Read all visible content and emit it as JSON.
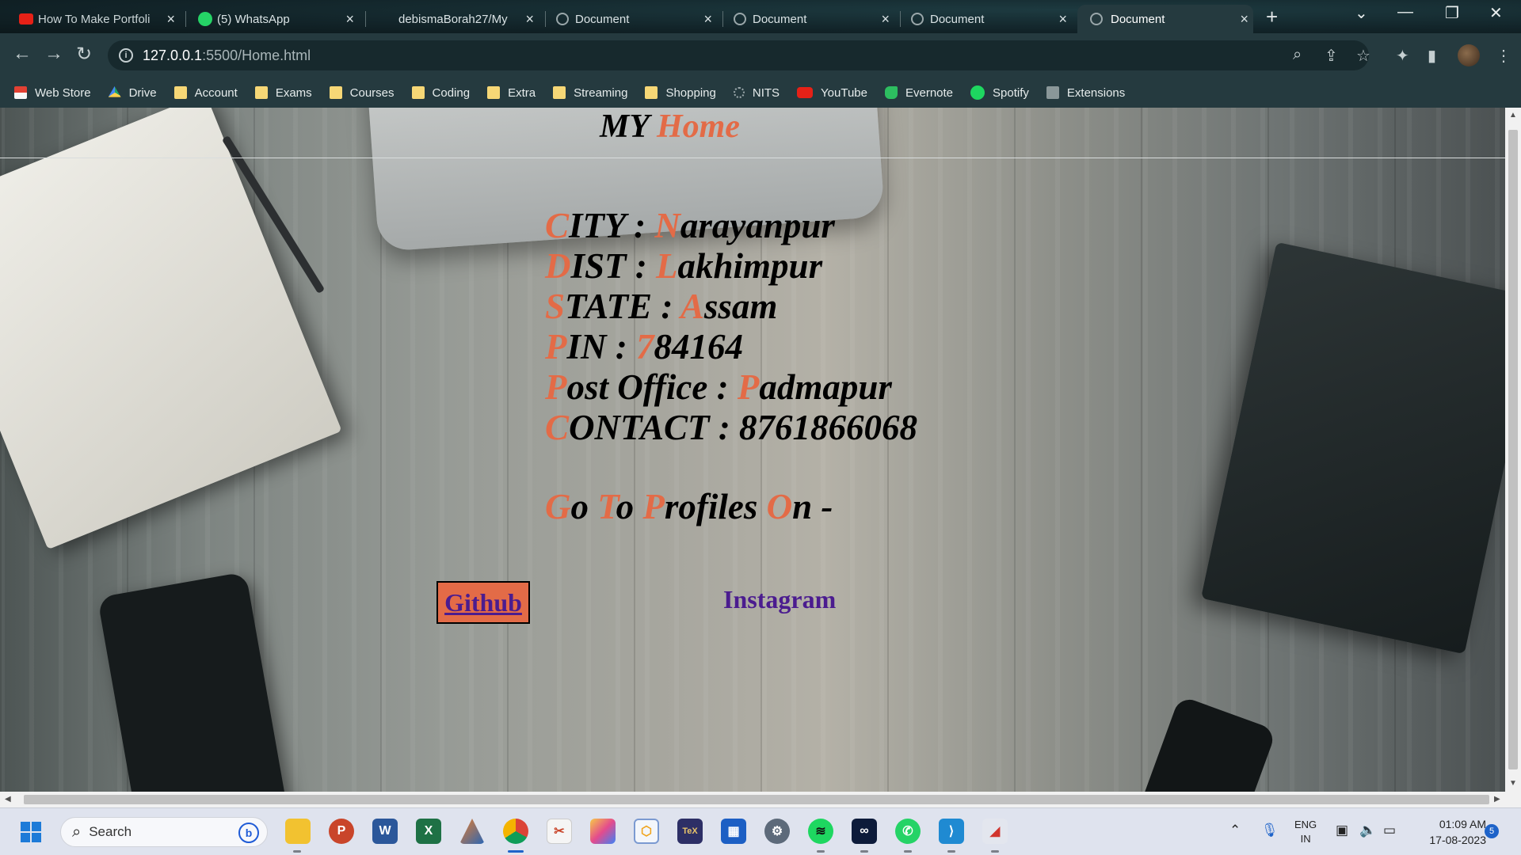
{
  "browser": {
    "tabs": [
      {
        "title": "How To Make Portfoli",
        "icon": "youtube-icon",
        "color": "#e62117"
      },
      {
        "title": "(5) WhatsApp",
        "icon": "whatsapp-icon",
        "color": "#25d366"
      },
      {
        "title": "debismaBorah27/My",
        "icon": "github-icon",
        "color": "#ffffff"
      },
      {
        "title": "Document",
        "icon": "globe-icon",
        "color": "#9aa7aa"
      },
      {
        "title": "Document",
        "icon": "globe-icon",
        "color": "#9aa7aa"
      },
      {
        "title": "Document",
        "icon": "globe-icon",
        "color": "#9aa7aa"
      },
      {
        "title": "Document",
        "icon": "globe-icon",
        "color": "#9aa7aa",
        "active": true
      }
    ],
    "url_host": "127.0.0.1",
    "url_path": ":5500/Home.html",
    "bookmarks": [
      {
        "label": "Web Store",
        "icon": "webstore-icon"
      },
      {
        "label": "Drive",
        "icon": "drive-icon"
      },
      {
        "label": "Account",
        "icon": "folder-icon"
      },
      {
        "label": "Exams",
        "icon": "folder-icon"
      },
      {
        "label": "Courses",
        "icon": "folder-icon"
      },
      {
        "label": "Coding",
        "icon": "folder-icon"
      },
      {
        "label": "Extra",
        "icon": "folder-icon"
      },
      {
        "label": "Streaming",
        "icon": "folder-icon"
      },
      {
        "label": "Shopping",
        "icon": "folder-icon"
      },
      {
        "label": "NITS",
        "icon": "nits-icon"
      },
      {
        "label": "YouTube",
        "icon": "youtube-icon"
      },
      {
        "label": "Evernote",
        "icon": "evernote-icon"
      },
      {
        "label": "Spotify",
        "icon": "spotify-icon"
      },
      {
        "label": "Extensions",
        "icon": "puzzle-icon"
      }
    ]
  },
  "page": {
    "brand_first": "MY",
    "brand_second": "Home",
    "accent_color": "#e36b47",
    "lines": [
      {
        "label_initial": "C",
        "label_rest": "ITY : ",
        "value_initial": "N",
        "value_rest": "arayanpur"
      },
      {
        "label_initial": "D",
        "label_rest": "IST : ",
        "value_initial": "L",
        "value_rest": "akhimpur"
      },
      {
        "label_initial": "S",
        "label_rest": "TATE : ",
        "value_initial": "A",
        "value_rest": "ssam"
      },
      {
        "label_initial": "P",
        "label_rest": "IN : ",
        "value_initial": "7",
        "value_rest": "84164"
      },
      {
        "label_initial": "P",
        "label_rest": "ost Office : ",
        "value_initial": "P",
        "value_rest": "admapur"
      },
      {
        "label_initial": "C",
        "label_rest": "ONTACT : ",
        "value_initial": "",
        "value_rest": "8761866068"
      }
    ],
    "profiles_heading": [
      {
        "initial": "G",
        "rest": "o "
      },
      {
        "initial": "T",
        "rest": "o "
      },
      {
        "initial": "P",
        "rest": "rofiles "
      },
      {
        "initial": "O",
        "rest": "n -"
      }
    ],
    "github_label": "Github",
    "instagram_label": "Instagram"
  },
  "taskbar": {
    "search_placeholder": "Search",
    "lang_line1": "ENG",
    "lang_line2": "IN",
    "time": "01:09 AM",
    "date": "17-08-2023",
    "notification_count": "5"
  }
}
